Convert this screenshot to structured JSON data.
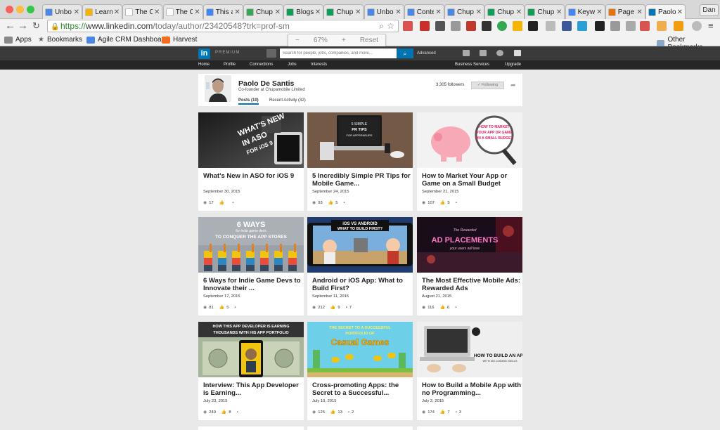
{
  "browser": {
    "tabs": [
      {
        "title": "Unbo",
        "fav": "#4a86e8"
      },
      {
        "title": "Learn",
        "fav": "#f4b400"
      },
      {
        "title": "The C",
        "fav": "#ffffff"
      },
      {
        "title": "The C",
        "fav": "#ffffff"
      },
      {
        "title": "This a",
        "fav": "#4285f4"
      },
      {
        "title": "Chup",
        "fav": "#34a853"
      },
      {
        "title": "Blogs",
        "fav": "#0f9d58"
      },
      {
        "title": "Chup",
        "fav": "#0f9d58"
      },
      {
        "title": "Unbo",
        "fav": "#4a86e8"
      },
      {
        "title": "Conte",
        "fav": "#4a86e8"
      },
      {
        "title": "Chup",
        "fav": "#4a86e8"
      },
      {
        "title": "Chup",
        "fav": "#0f9d58"
      },
      {
        "title": "Chup",
        "fav": "#0f9d58"
      },
      {
        "title": "Keyw",
        "fav": "#4285f4"
      },
      {
        "title": "Page",
        "fav": "#e8710a"
      },
      {
        "title": "Paolo",
        "fav": "#0077b5"
      }
    ],
    "tab_close": "✕",
    "user": "Dan",
    "url_scheme": "https://",
    "url_host": "www.linkedin.com",
    "url_path": "/today/author/23420548?trk=prof-sm",
    "zoom": {
      "minus": "−",
      "level": "67%",
      "plus": "+",
      "reset": "Reset"
    },
    "bookmarks": [
      {
        "label": "Apps",
        "color": "#888"
      },
      {
        "label": "Bookmarks",
        "color": "#666"
      },
      {
        "label": "Agile CRM Dashboard",
        "color": "#4a86e8"
      },
      {
        "label": "Harvest",
        "color": "#f36c21"
      }
    ],
    "other_bookmarks": "Other Bookmarks"
  },
  "linkedin": {
    "logo": "in",
    "premium": "PREMIUM",
    "search_placeholder": "Search for people, jobs, companies, and more...",
    "advanced": "Advanced",
    "nav": [
      "Home",
      "Profile",
      "Connections",
      "Jobs",
      "Interests"
    ],
    "business_services": "Business Services",
    "upgrade": "Upgrade"
  },
  "profile": {
    "name": "Paolo De Santis",
    "title": "Co-founder at Chupamobile Limited",
    "followers": "3,305 followers",
    "following": "✓ Following",
    "tabs": [
      "Posts (10)",
      "Recent Activity (32)"
    ]
  },
  "posts": [
    {
      "title": "What's New in ASO for iOS 9",
      "date": "September 30, 2015",
      "views": "17",
      "likes": "",
      "comments": "",
      "thumb": "aso",
      "overlay": "WHAT'S NEW IN ASO FOR iOS 9"
    },
    {
      "title": "5 Incredibly Simple PR Tips for Mobile Game...",
      "date": "September 24, 2015",
      "views": "93",
      "likes": "5",
      "comments": "",
      "thumb": "pr",
      "overlay": "5 SIMPLE PR TIPS FOR APPRENEURS"
    },
    {
      "title": "How to Market Your App or Game on a Small Budget",
      "date": "September 21, 2015",
      "views": "107",
      "likes": "5",
      "comments": "",
      "thumb": "market",
      "overlay": "HOW TO MARKET YOUR APP OR GAME ON A SMALL BUDGET"
    },
    {
      "title": "6 Ways for Indie Game Devs to Innovate their ...",
      "date": "September 17, 2015",
      "views": "81",
      "likes": "5",
      "comments": "",
      "thumb": "sixways",
      "overlay": "6 WAYS for indie game devs TO CONQUER THE APP STORES"
    },
    {
      "title": "Android or iOS App: What to Build First?",
      "date": "September 11, 2015",
      "views": "212",
      "likes": "9",
      "comments": "7",
      "thumb": "android",
      "overlay": "iOS VS ANDROID WHAT TO BUILD FIRST?"
    },
    {
      "title": "The Most Effective Mobile Ads: Rewarded Ads",
      "date": "August 21, 2015",
      "views": "116",
      "likes": "6",
      "comments": "",
      "thumb": "ads",
      "overlay": "The Rewarded AD PLACEMENTS your users will love"
    },
    {
      "title": "Interview: This App Developer is Earning...",
      "date": "July 23, 2015",
      "views": "240",
      "likes": "8",
      "comments": "",
      "thumb": "interview",
      "overlay": "HOW THIS APP DEVELOPER IS EARNING THOUSANDS WITH HIS APP PORTFOLIO"
    },
    {
      "title": "Cross-promoting Apps: the Secret to a Successful...",
      "date": "July 10, 2015",
      "views": "125",
      "likes": "13",
      "comments": "2",
      "thumb": "cross",
      "overlay": "THE SECRET TO A SUCCESSFUL PORTFOLIO OF Casual Games"
    },
    {
      "title": "How to Build a Mobile App with no Programming...",
      "date": "July 2, 2015",
      "views": "174",
      "likes": "7",
      "comments": "3",
      "thumb": "build",
      "overlay": "HOW TO BUILD AN APP WITH NO CODING SKILLS"
    }
  ],
  "colors": {
    "linkedin_blue": "#0077b5",
    "header": "#3a3a3a",
    "subnav": "#262626"
  }
}
